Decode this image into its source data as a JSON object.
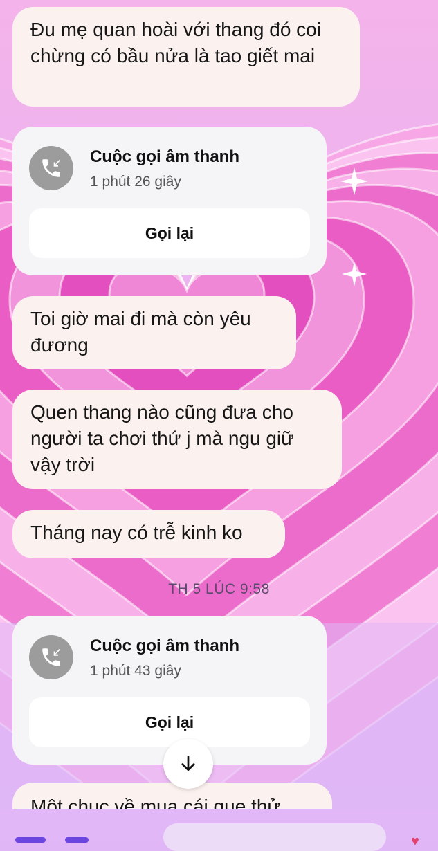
{
  "messages": [
    {
      "type": "text",
      "text": "Đu mẹ quan hoài với thang đó coi chừng có bầu nửa là tao giết mai"
    },
    {
      "type": "call",
      "title": "Cuộc gọi âm thanh",
      "duration": "1 phút 26 giây",
      "action": "Gọi lại"
    },
    {
      "type": "text",
      "text": "Toi giờ mai đi mà còn yêu đương"
    },
    {
      "type": "text",
      "text": "Quen thang nào cũng đưa cho người ta chơi thứ j mà ngu giữ vậy trời"
    },
    {
      "type": "text",
      "text": "Tháng nay có trễ kinh ko"
    },
    {
      "type": "timestamp",
      "text": "TH 5 LÚC 9:58"
    },
    {
      "type": "call",
      "title": "Cuộc gọi âm thanh",
      "duration": "1 phút 43 giây",
      "action": "Gọi lại"
    },
    {
      "type": "text_partial",
      "text": "Một chục về mua cái que thử"
    }
  ],
  "icons": {
    "call": "phone-incoming-icon",
    "scroll": "arrow-down-icon",
    "sparkle": "sparkle-icon",
    "heart": "heart-icon"
  },
  "colors": {
    "bubble_bg": "#fbf1ef",
    "call_card_bg": "#f5f4f6",
    "call_icon_bg": "#9c9c9c",
    "theme_pink": "#f38fdc",
    "theme_lavender": "#e1b6f6",
    "accent": "#6a45e0"
  }
}
